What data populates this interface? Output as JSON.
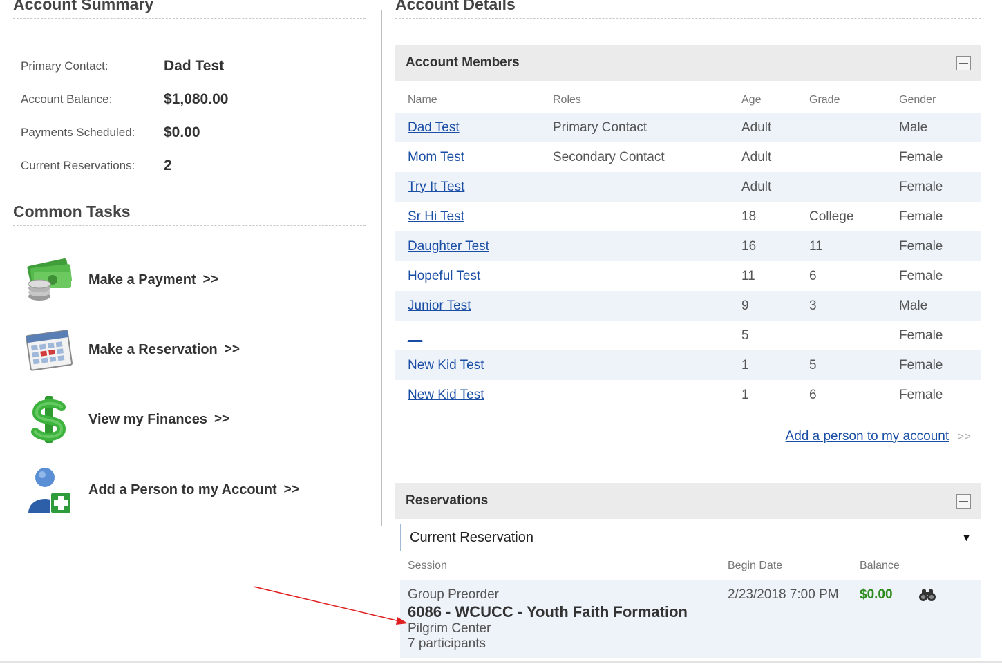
{
  "left": {
    "account_summary_title": "Account Summary",
    "summary": [
      {
        "label": "Primary Contact:",
        "value": "Dad Test"
      },
      {
        "label": "Account Balance:",
        "value": "$1,080.00"
      },
      {
        "label": "Payments Scheduled:",
        "value": "$0.00"
      },
      {
        "label": "Current Reservations:",
        "value": "2"
      }
    ],
    "common_tasks_title": "Common Tasks",
    "tasks": [
      {
        "label": "Make a Payment",
        "arrow": ">>",
        "icon": "money-icon"
      },
      {
        "label": "Make a Reservation",
        "arrow": ">>",
        "icon": "calendar-icon"
      },
      {
        "label": "View my Finances",
        "arrow": ">>",
        "icon": "dollar-sign-icon"
      },
      {
        "label": "Add a Person to my Account",
        "arrow": ">>",
        "icon": "add-user-icon"
      }
    ]
  },
  "right": {
    "account_details_title": "Account Details",
    "members_panel": {
      "title": "Account Members",
      "columns": {
        "name": "Name",
        "roles": "Roles",
        "age": "Age",
        "grade": "Grade",
        "gender": "Gender"
      },
      "rows": [
        {
          "name": "Dad Test",
          "role": "Primary Contact",
          "age": "Adult",
          "grade": "",
          "gender": "Male"
        },
        {
          "name": "Mom Test",
          "role": "Secondary Contact",
          "age": "Adult",
          "grade": "",
          "gender": "Female"
        },
        {
          "name": "Try It Test",
          "role": "",
          "age": "Adult",
          "grade": "",
          "gender": "Female"
        },
        {
          "name": "Sr Hi Test",
          "role": "",
          "age": "18",
          "grade": "College",
          "gender": "Female"
        },
        {
          "name": "Daughter Test",
          "role": "",
          "age": "16",
          "grade": "11",
          "gender": "Female"
        },
        {
          "name": "Hopeful Test",
          "role": "",
          "age": "11",
          "grade": "6",
          "gender": "Female"
        },
        {
          "name": "Junior Test",
          "role": "",
          "age": "9",
          "grade": "3",
          "gender": "Male"
        },
        {
          "name": "__",
          "role": "",
          "age": "5",
          "grade": "",
          "gender": "Female"
        },
        {
          "name": "New Kid Test",
          "role": "",
          "age": "1",
          "grade": "5",
          "gender": "Female"
        },
        {
          "name": "New Kid Test",
          "role": "",
          "age": "1",
          "grade": "6",
          "gender": "Female"
        }
      ],
      "add_person_link": "Add a person to my account",
      "add_person_arrow": ">>"
    },
    "reservations_panel": {
      "title": "Reservations",
      "select_value": "Current Reservation",
      "columns": {
        "session": "Session",
        "begin_date": "Begin Date",
        "balance": "Balance"
      },
      "rows": [
        {
          "type": "Group Preorder",
          "name": "6086 - WCUCC - Youth Faith Formation",
          "place": "Pilgrim Center",
          "participants": "7 participants",
          "begin_date": "2/23/2018 7:00 PM",
          "balance": "$0.00",
          "action_icon": "binoculars-icon"
        }
      ]
    }
  },
  "colors": {
    "link": "#1a4ea5",
    "balance_green": "#2e8b1e",
    "panel_header": "#ebebeb",
    "row_alt": "#eef3fa",
    "annotation": "#e02020"
  }
}
